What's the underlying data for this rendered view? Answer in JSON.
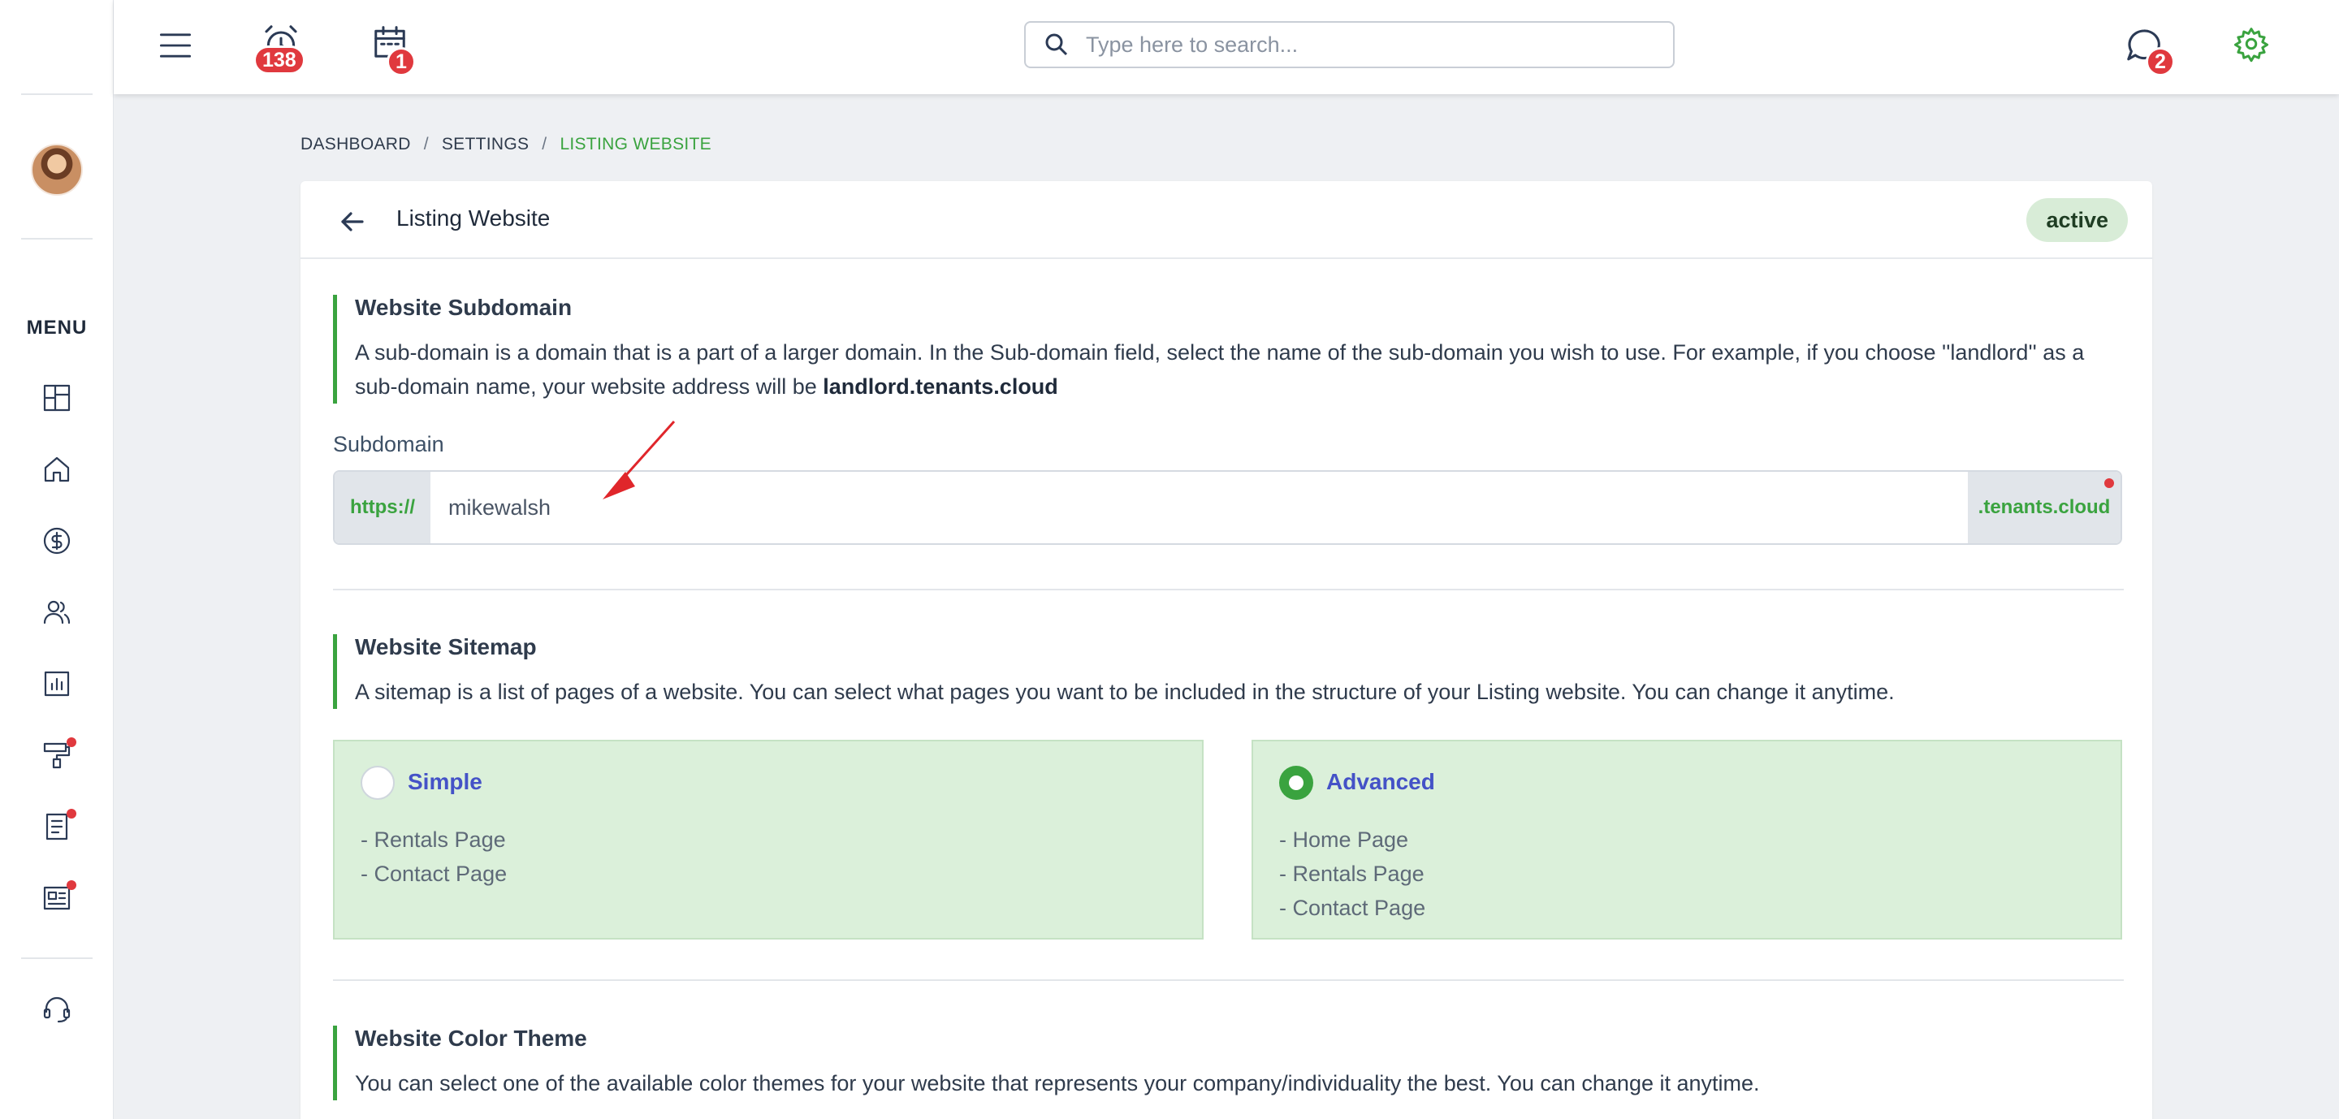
{
  "topbar": {
    "tasks_badge": "138",
    "calendar_badge": "1",
    "messages_badge": "2",
    "search_placeholder": "Type here to search..."
  },
  "sidebar": {
    "menu_label": "MENU",
    "items": [
      {
        "name": "dashboard",
        "icon": "dashboard-icon",
        "dot": false
      },
      {
        "name": "properties",
        "icon": "home-icon",
        "dot": false
      },
      {
        "name": "accounting",
        "icon": "dollar-icon",
        "dot": false
      },
      {
        "name": "contacts",
        "icon": "users-icon",
        "dot": false
      },
      {
        "name": "reports",
        "icon": "chart-icon",
        "dot": false
      },
      {
        "name": "maintenance",
        "icon": "paint-roller-icon",
        "dot": true
      },
      {
        "name": "documents",
        "icon": "document-icon",
        "dot": true
      },
      {
        "name": "listings",
        "icon": "newspaper-icon",
        "dot": true
      }
    ],
    "support_icon": "headset-icon"
  },
  "breadcrumb": {
    "items": [
      "DASHBOARD",
      "SETTINGS"
    ],
    "current": "LISTING WEBSITE"
  },
  "card": {
    "title": "Listing Website",
    "status": "active"
  },
  "subdomain_section": {
    "heading": "Website Subdomain",
    "text": "A sub-domain is a domain that is a part of a larger domain. In the Sub-domain field, select the name of the sub-domain you wish to use. For example, if you choose ''landlord'' as a sub-domain name, your website address will be ",
    "example_bold": "landlord.tenants.cloud",
    "field_label": "Subdomain",
    "prefix": "https://",
    "value": "mikewalsh",
    "suffix": ".tenants.cloud"
  },
  "sitemap_section": {
    "heading": "Website Sitemap",
    "text": "A sitemap is a list of pages of a website. You can select what pages you want to be included in the structure of your Listing website. You can change it anytime.",
    "options": [
      {
        "title": "Simple",
        "selected": false,
        "pages": [
          "- Rentals Page",
          "- Contact Page"
        ]
      },
      {
        "title": "Advanced",
        "selected": true,
        "pages": [
          "- Home Page",
          "- Rentals Page",
          "- Contact Page"
        ]
      }
    ]
  },
  "color_section": {
    "heading": "Website Color Theme",
    "text": "You can select one of the available color themes for your website that represents your company/individuality the best. You can change it anytime."
  },
  "colors": {
    "accent_green": "#3aa33f",
    "badge_red": "#e0393e",
    "option_bg": "#dbf0da",
    "option_title": "#4452c7"
  }
}
